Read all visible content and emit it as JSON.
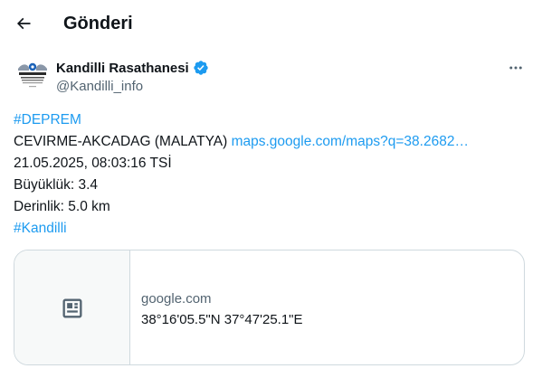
{
  "header": {
    "back_icon": "arrow-left-icon",
    "title": "Gönderi"
  },
  "author": {
    "name": "Kandilli Rasathanesi",
    "handle": "@Kandilli_info",
    "verified_color": "#1d9bf0",
    "avatar_logo_text": "KANDİLLİ RASATHANESİ VE DEPREM ARAŞTIRMA ENSTİTÜSÜ"
  },
  "more_icon": "more-horizontal-icon",
  "tweet": {
    "hashtag1": "#DEPREM",
    "location": "CEVIRME-AKCADAG (MALATYA) ",
    "map_link": "maps.google.com/maps?q=38.2682…",
    "datetime": "21.05.2025, 08:03:16 TSİ",
    "magnitude": "Büyüklük: 3.4",
    "depth": "Derinlik: 5.0 km",
    "hashtag2": "#Kandilli"
  },
  "card": {
    "thumb_icon": "article-icon",
    "domain": "google.com",
    "title": "38°16'05.5\"N 37°47'25.1\"E"
  },
  "colors": {
    "link": "#1d9bf0",
    "secondary_text": "#536471",
    "border": "#cfd9de"
  }
}
